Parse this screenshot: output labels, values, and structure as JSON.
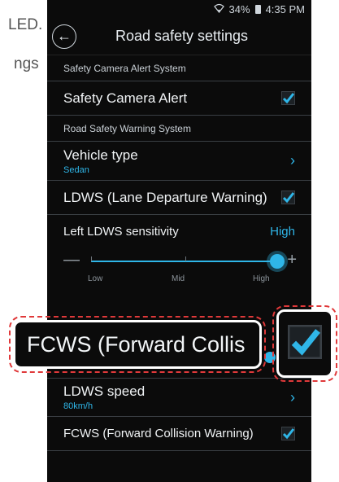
{
  "background": {
    "fragment_1": "LED.",
    "fragment_2": "ngs"
  },
  "status_bar": {
    "signal_icon": "wifi-icon",
    "battery_percent": "34%",
    "time": "4:35 PM"
  },
  "header": {
    "title": "Road safety settings",
    "back_icon": "back-arrow-icon"
  },
  "sections": {
    "safety_camera_section": "Safety Camera Alert System",
    "road_safety_section": "Road Safety Warning System"
  },
  "rows": {
    "safety_camera_alert": {
      "label": "Safety Camera Alert",
      "checked": true
    },
    "vehicle_type": {
      "label": "Vehicle type",
      "value": "Sedan"
    },
    "ldws": {
      "label": "LDWS (Lane Departure Warning)",
      "checked": true
    },
    "left_ldws_sensitivity": {
      "label": "Left LDWS sensitivity",
      "value": "High"
    },
    "ldws_speed": {
      "label": "LDWS speed",
      "value": "80km/h"
    },
    "fcws": {
      "label": "FCWS (Forward Collision Warning)",
      "checked": true
    }
  },
  "slider": {
    "minus": "—",
    "plus": "+",
    "labels": {
      "low": "Low",
      "mid": "Mid",
      "high": "High"
    },
    "level": 1.0
  },
  "callout": {
    "text": "FCWS (Forward Collis",
    "checked": true
  },
  "colors": {
    "accent": "#2fb6e8",
    "background": "#0b0b0b",
    "callout_dash": "#e0393a"
  }
}
